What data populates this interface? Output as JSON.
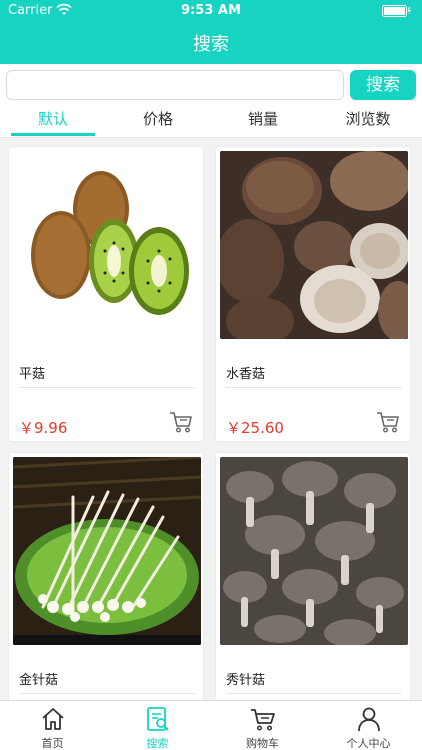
{
  "status": {
    "carrier": "Carrier",
    "time": "9:53 AM"
  },
  "nav": {
    "title": "搜索"
  },
  "search": {
    "placeholder": "",
    "button_label": "搜索"
  },
  "sort_tabs": [
    {
      "label": "默认",
      "active": true
    },
    {
      "label": "价格",
      "active": false
    },
    {
      "label": "销量",
      "active": false
    },
    {
      "label": "浏览数",
      "active": false
    }
  ],
  "products": [
    {
      "name": "平菇",
      "price": "￥9.96",
      "image": "kiwi-fruit"
    },
    {
      "name": "水香菇",
      "price": "￥25.60",
      "image": "shiitake-mushrooms"
    },
    {
      "name": "金针菇",
      "price": "",
      "image": "enoki-mushrooms"
    },
    {
      "name": "秀针菇",
      "price": "",
      "image": "oyster-mushrooms"
    }
  ],
  "tabbar": [
    {
      "label": "首页",
      "icon": "home-icon",
      "active": false
    },
    {
      "label": "搜索",
      "icon": "search-doc-icon",
      "active": true
    },
    {
      "label": "购物车",
      "icon": "cart-icon",
      "active": false
    },
    {
      "label": "个人中心",
      "icon": "user-icon",
      "active": false
    }
  ],
  "colors": {
    "accent": "#17d3c1",
    "price": "#e23a2c"
  }
}
